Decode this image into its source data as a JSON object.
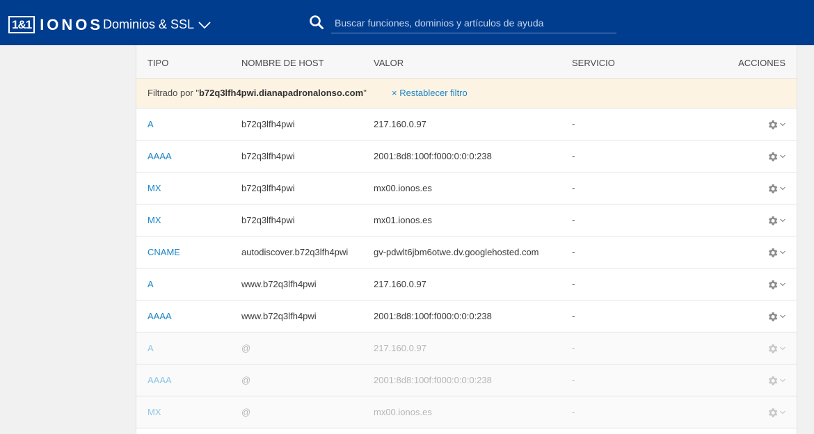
{
  "header": {
    "logo_mark": "1&1",
    "logo_text": "IONOS",
    "product_menu_label": "Dominios & SSL",
    "search_placeholder": "Buscar funciones, dominios y artículos de ayuda",
    "background_color": "#003d8f"
  },
  "table": {
    "columns": {
      "tipo": "TIPO",
      "host": "NOMBRE DE HOST",
      "valor": "VALOR",
      "servicio": "SERVICIO",
      "acciones": "ACCIONES"
    },
    "filter": {
      "prefix": "Filtrado por \"",
      "value": "b72q3lfh4pwi.dianapadronalonso.com",
      "suffix": "\"",
      "reset_label": "× Restablecer filtro"
    },
    "rows": [
      {
        "tipo": "A",
        "host": "b72q3lfh4pwi",
        "valor": "217.160.0.97",
        "servicio": "-",
        "disabled": false
      },
      {
        "tipo": "AAAA",
        "host": "b72q3lfh4pwi",
        "valor": "2001:8d8:100f:f000:0:0:0:238",
        "servicio": "-",
        "disabled": false
      },
      {
        "tipo": "MX",
        "host": "b72q3lfh4pwi",
        "valor": "mx00.ionos.es",
        "servicio": "-",
        "disabled": false
      },
      {
        "tipo": "MX",
        "host": "b72q3lfh4pwi",
        "valor": "mx01.ionos.es",
        "servicio": "-",
        "disabled": false
      },
      {
        "tipo": "CNAME",
        "host": "autodiscover.b72q3lfh4pwi",
        "valor": "gv-pdwlt6jbm6otwe.dv.googlehosted.com",
        "servicio": "-",
        "disabled": false
      },
      {
        "tipo": "A",
        "host": "www.b72q3lfh4pwi",
        "valor": "217.160.0.97",
        "servicio": "-",
        "disabled": false
      },
      {
        "tipo": "AAAA",
        "host": "www.b72q3lfh4pwi",
        "valor": "2001:8d8:100f:f000:0:0:0:238",
        "servicio": "-",
        "disabled": false
      },
      {
        "tipo": "A",
        "host": "@",
        "valor": "217.160.0.97",
        "servicio": "-",
        "disabled": true
      },
      {
        "tipo": "AAAA",
        "host": "@",
        "valor": "2001:8d8:100f:f000:0:0:0:238",
        "servicio": "-",
        "disabled": true
      },
      {
        "tipo": "MX",
        "host": "@",
        "valor": "mx00.ionos.es",
        "servicio": "-",
        "disabled": true
      }
    ],
    "row_action_icon": "gear-icon",
    "accent_link_color": "#1b86c7"
  }
}
